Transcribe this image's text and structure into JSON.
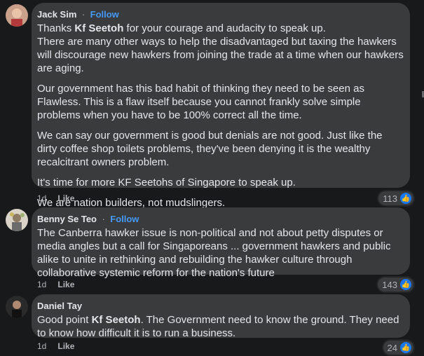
{
  "comments": [
    {
      "author": "Jack Sim",
      "separator": "·",
      "follow": "Follow",
      "paragraphs": [
        {
          "pre": "Thanks ",
          "mention": "Kf Seetoh",
          "post": " for your courage and audacity to speak up.\nThere are many other ways to help the disadvantaged but taxing the hawkers will discourage new hawkers from joining the trade at a time when our hawkers are aging."
        },
        {
          "text": "Our government has this bad habit of thinking they need to be seen as Flawless. This is a flaw itself because you cannot frankly solve simple problems when you have to be 100% correct all the time."
        },
        {
          "text": "We can say our government is good but denials are not good. Just like the dirty coffee shop toilets problems, they've been denying it is the wealthy recalcitrant owners problem."
        },
        {
          "text": "It's time for more KF Seetohs of Singapore to speak up."
        },
        {
          "text": "We are nation builders, not mudslingers.\nLet's talk about solutions. Mister Minister."
        }
      ],
      "time": "1d",
      "like": "Like",
      "reactions": "113",
      "reaction_icon": "thumbs-up-icon"
    },
    {
      "author": "Benny Se Teo",
      "separator": "·",
      "follow": "Follow",
      "paragraphs": [
        {
          "text": "The Canberra hawker issue is non-political and not about petty disputes or media angles but a call for Singaporeans ... government hawkers and public alike to unite in rethinking and rebuilding the hawker culture through collaborative systemic reform for the nation's future"
        }
      ],
      "time": "1d",
      "like": "Like",
      "reactions": "143",
      "reaction_icon": "thumbs-up-icon"
    },
    {
      "author": "Daniel Tay",
      "paragraphs": [
        {
          "pre": "Good point ",
          "mention": "Kf Seetoh",
          "post": ". The Government need to know the ground. They need to know how difficult it is to run a business."
        }
      ],
      "time": "1d",
      "like": "Like",
      "reactions": "24",
      "reaction_icon": "thumbs-up-icon"
    }
  ],
  "colors": {
    "background": "#18191a",
    "bubble": "#3a3b3c",
    "text": "#e4e6eb",
    "secondary_text": "#b0b3b8",
    "follow_link": "#4599ff",
    "like_blue": "#1877f2"
  }
}
